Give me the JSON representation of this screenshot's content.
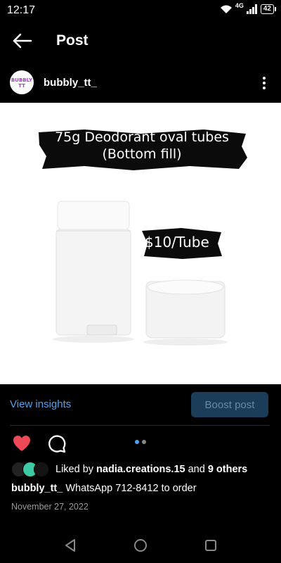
{
  "status": {
    "time": "12:17",
    "network": "4G",
    "battery": "42"
  },
  "header": {
    "back_icon": "arrow-left-icon",
    "title": "Post"
  },
  "profile": {
    "avatar_text_line1": "BUBBLY TT",
    "avatar_text_line2": "",
    "username": "bubbly_tt_",
    "more_icon": "more-vertical-icon"
  },
  "post_image": {
    "headline_line1": "75g Deodorant oval tubes",
    "headline_line2": "(Bottom fill)",
    "price": "$10/Tube"
  },
  "insights": {
    "view_insights": "View insights",
    "boost_post": "Boost post"
  },
  "actions": {
    "liked": true,
    "carousel_count": 2,
    "carousel_active": 1
  },
  "likes": {
    "prefix": "Liked by",
    "user": "nadia.creations.15",
    "middle": "and",
    "others": "9 others"
  },
  "caption": {
    "user": "bubbly_tt_",
    "text": "WhatsApp 712-8412 to order"
  },
  "date": "November 27, 2022",
  "colors": {
    "accent": "#4ca3f0",
    "heart": "#ed4956",
    "boost_bg": "#1b3d5a"
  }
}
